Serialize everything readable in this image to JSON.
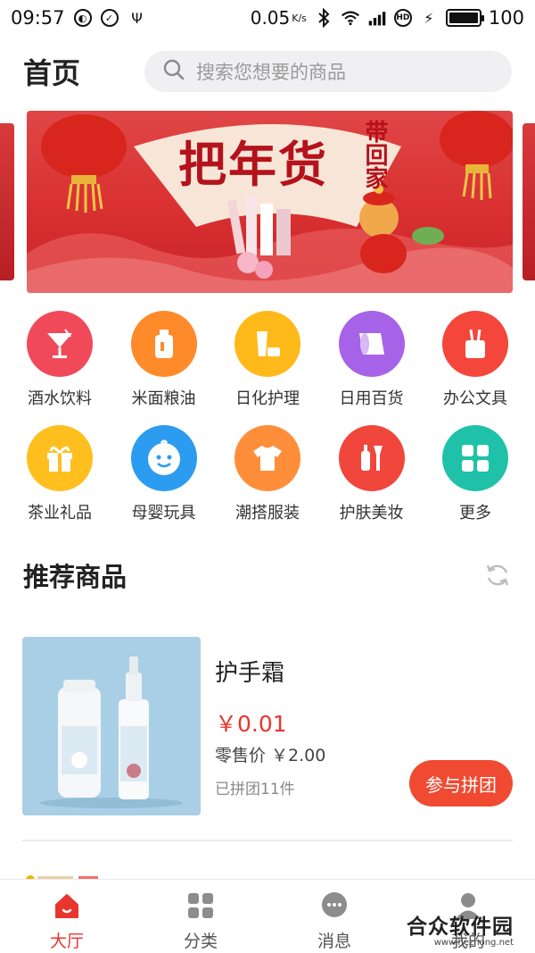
{
  "status_bar": {
    "time": "09:57",
    "network_speed": "0.05",
    "network_unit": "K/s",
    "battery": "100",
    "battery_level": 1.0,
    "left_icons": [
      "sync-icon",
      "check-circle-icon",
      "usb-icon"
    ],
    "right_icons": [
      "bluetooth-icon",
      "wifi-icon",
      "signal-4g-icon",
      "hd-icon",
      "charging-icon",
      "battery-icon"
    ]
  },
  "header": {
    "title": "首页",
    "search_placeholder": "搜索您想要的商品"
  },
  "banner": {
    "headline": "把年货",
    "tagline": "带回家"
  },
  "categories": [
    {
      "label": "酒水饮料",
      "icon": "cocktail-icon",
      "color": "#f04a5a"
    },
    {
      "label": "米面粮油",
      "icon": "oil-bottle-icon",
      "color": "#ff8a2a"
    },
    {
      "label": "日化护理",
      "icon": "cosmetics-icon",
      "color": "#ffb91a"
    },
    {
      "label": "日用百货",
      "icon": "tissue-roll-icon",
      "color": "#a763e8"
    },
    {
      "label": "办公文具",
      "icon": "stationery-icon",
      "color": "#f4463a"
    },
    {
      "label": "茶业礼品",
      "icon": "gift-icon",
      "color": "#ffbf1f"
    },
    {
      "label": "母婴玩具",
      "icon": "baby-face-icon",
      "color": "#2c9cf0"
    },
    {
      "label": "潮搭服装",
      "icon": "tshirt-icon",
      "color": "#ff8e3a"
    },
    {
      "label": "护肤美妆",
      "icon": "skincare-icon",
      "color": "#f0463c"
    },
    {
      "label": "更多",
      "icon": "grid-more-icon",
      "color": "#1fc2a8"
    }
  ],
  "recommend": {
    "title": "推荐商品",
    "product": {
      "name": "护手霜",
      "price": "￥0.01",
      "retail_label": "零售价",
      "retail_price": "￥2.00",
      "joined": "已拼团11件",
      "button": "参与拼团"
    }
  },
  "bottom_nav": [
    {
      "label": "大厅",
      "icon": "home-icon",
      "active": true
    },
    {
      "label": "分类",
      "icon": "category-grid-icon",
      "active": false
    },
    {
      "label": "消息",
      "icon": "message-icon",
      "active": false
    },
    {
      "label": "我的",
      "icon": "user-icon",
      "active": false
    }
  ],
  "watermark": {
    "main": "合众软件园",
    "sub": "www.hezhong.net"
  },
  "colors": {
    "accent": "#e8362f",
    "button": "#f04a32",
    "search_bg": "#f0f0f2"
  }
}
